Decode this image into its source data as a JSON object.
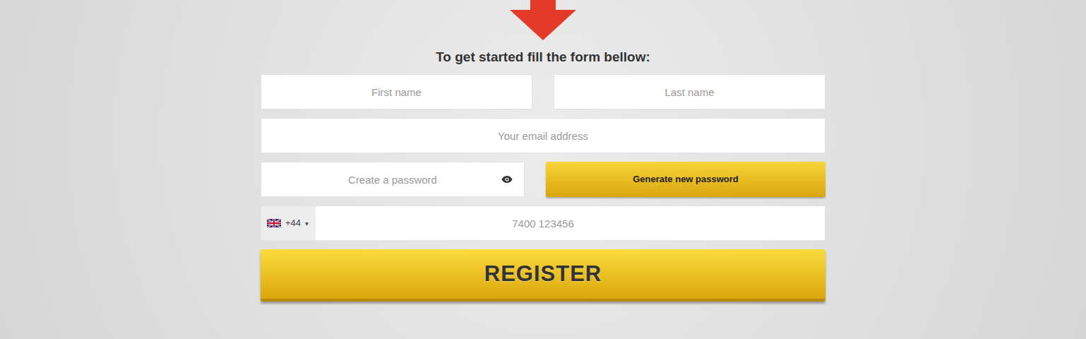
{
  "heading": "To get started fill the form bellow:",
  "form": {
    "first_name": {
      "placeholder": "First name"
    },
    "last_name": {
      "placeholder": "Last name"
    },
    "email": {
      "placeholder": "Your email address"
    },
    "password": {
      "placeholder": "Create a password"
    },
    "generate_button": "Generate new password",
    "phone": {
      "country_code": "+44",
      "caret": "▾",
      "placeholder": "7400 123456"
    },
    "register_button": "REGISTER"
  }
}
